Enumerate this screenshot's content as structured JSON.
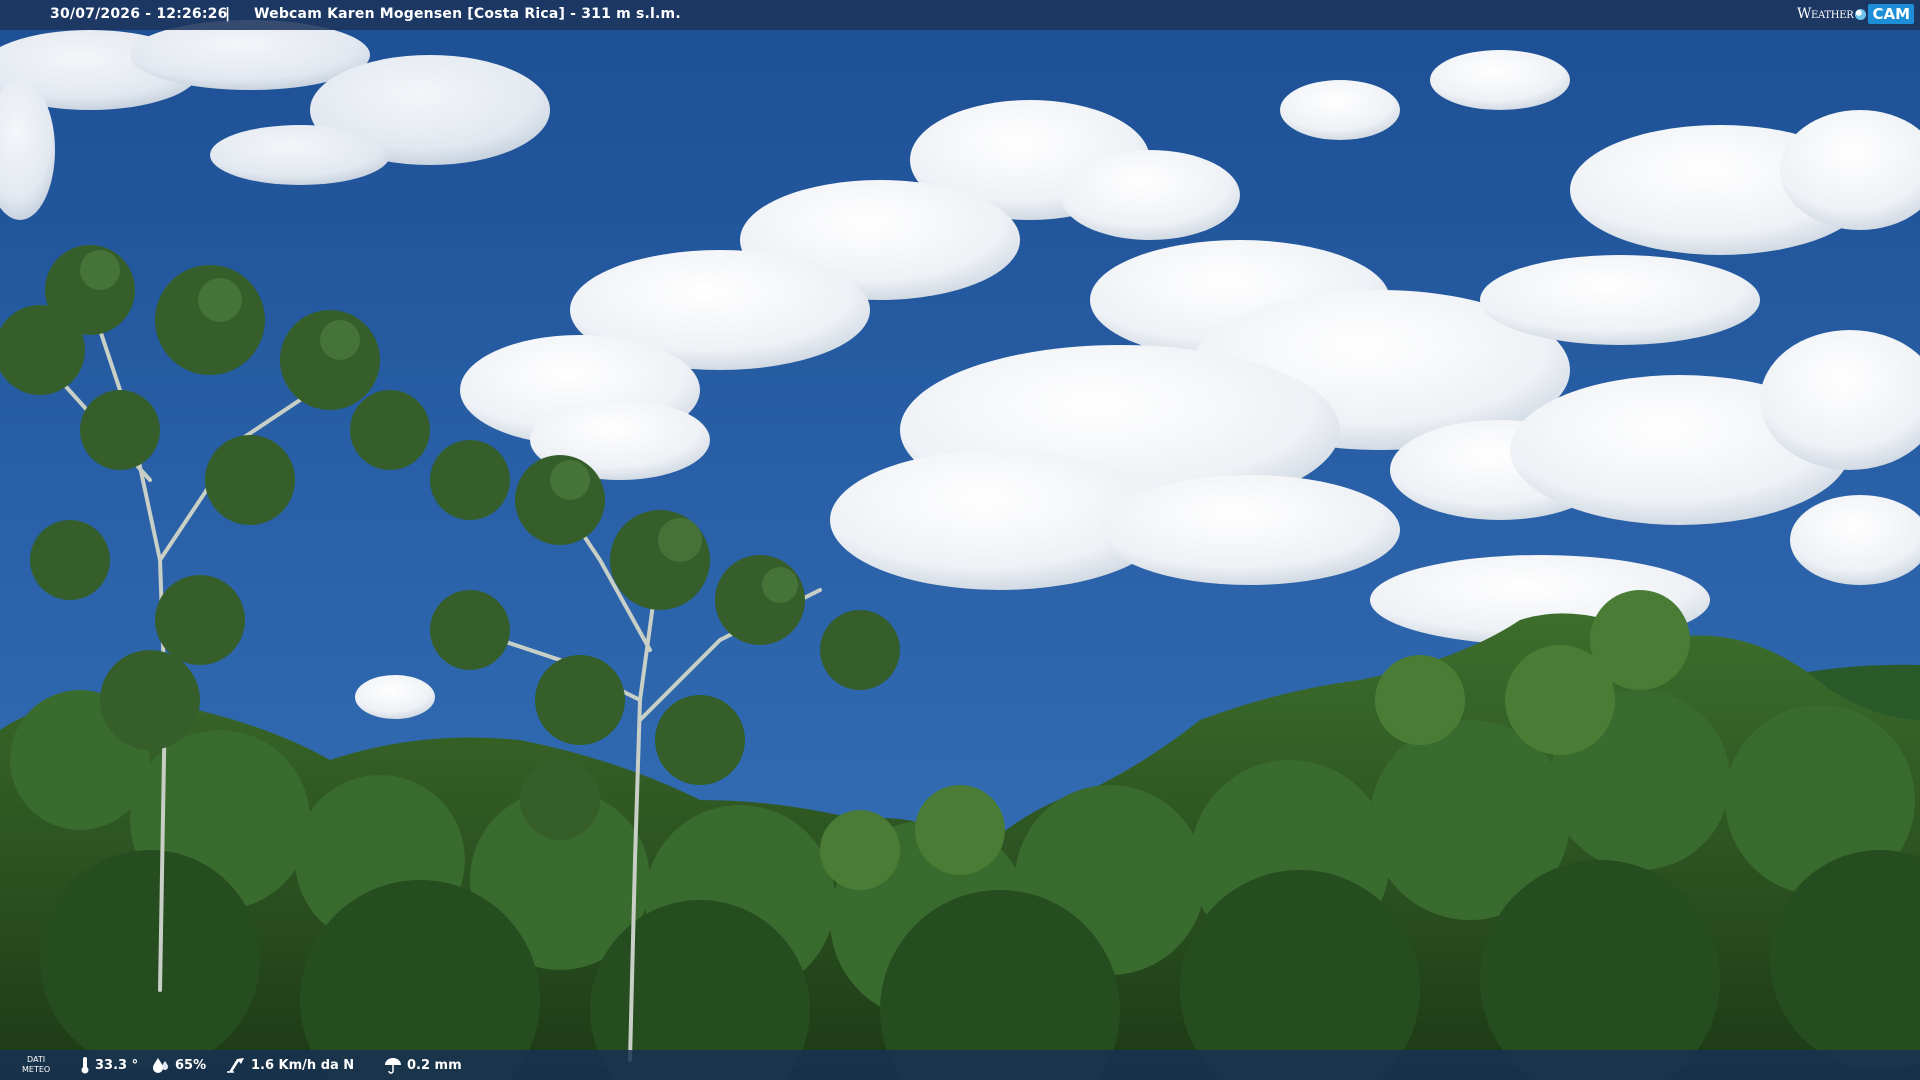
{
  "header": {
    "timestamp": "30/07/2026 - 12:26:26",
    "separator": "|",
    "title": "Webcam Karen Mogensen [Costa Rica] - 311 m s.l.m."
  },
  "logo": {
    "word": "Weather",
    "badge": "CAM"
  },
  "weather": {
    "label_line1": "DATI",
    "label_line2": "METEO",
    "temperature": "33.3 °",
    "humidity": "65%",
    "wind": "1.6 Km/h da N",
    "rain": "0.2 mm"
  },
  "scene": {
    "sky_color": "#2c62a8",
    "cloud_color": "#f2f5f8",
    "foliage_color": "#2f5a24"
  }
}
